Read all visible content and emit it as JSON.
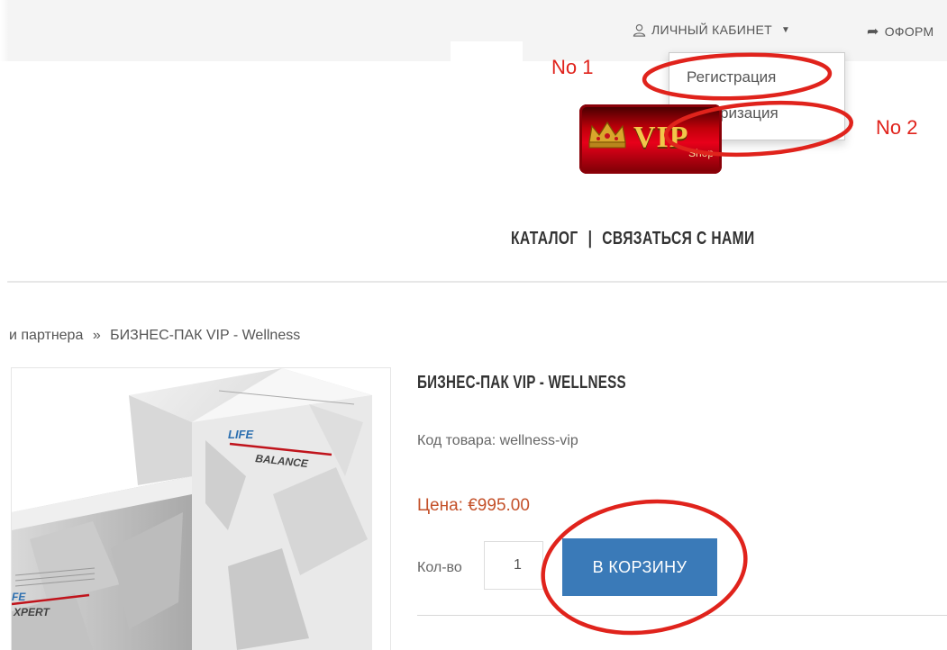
{
  "topbar": {
    "account_label": "ЛИЧНЫЙ КАБИНЕТ",
    "checkout_label": "ОФОРМ",
    "account_icon": "user-icon",
    "checkout_icon": "share-icon"
  },
  "account_menu": {
    "items": [
      {
        "label": "Регистрация"
      },
      {
        "label": "Авторизация"
      }
    ]
  },
  "annotations": {
    "label_1": "No 1",
    "label_2": "No 2",
    "color": "#e0231c"
  },
  "logo": {
    "text": "VIP",
    "subtext": "Shop"
  },
  "nav": {
    "catalog": "КАТАЛОГ",
    "separator": "|",
    "contact": "СВЯЗАТЬСЯ С НАМИ"
  },
  "breadcrumb": {
    "items": [
      "и партнера",
      "БИЗНЕС-ПАК VIP - Wellness"
    ],
    "separator": "»"
  },
  "product": {
    "title": "БИЗНЕС-ПАК VIP - WELLNESS",
    "sku_label": "Код товара: wellness-vip",
    "price_label": "Цена: €995.00",
    "qty_label": "Кол-во",
    "qty_value": "1",
    "add_to_cart": "В КОРЗИНУ",
    "image_text_top": "LIFE BALANCE",
    "image_text_bottom": "LIFE EXPERT"
  },
  "colors": {
    "accent_blue": "#3a7ab8",
    "price": "#c4512a",
    "annotation_red": "#e0231c"
  }
}
